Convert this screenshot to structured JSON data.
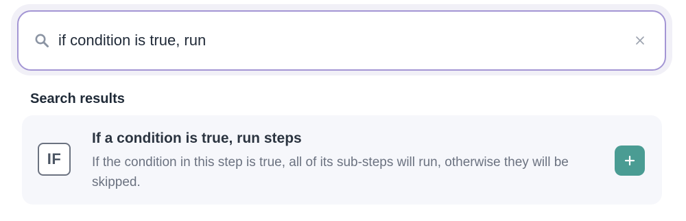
{
  "search": {
    "value": "if condition is true, run",
    "placeholder": ""
  },
  "results_section": {
    "title": "Search results"
  },
  "results": [
    {
      "icon_label": "IF",
      "title": "If a condition is true, run steps",
      "description": "If the condition in this step is true, all of its sub-steps will run, otherwise they will be skipped."
    }
  ],
  "icons": {
    "search": "search-icon",
    "clear": "close-icon",
    "add": "plus-icon"
  },
  "colors": {
    "focus_border": "#a395d4",
    "add_button": "#4a9c93",
    "card_background": "#f6f7fb"
  }
}
